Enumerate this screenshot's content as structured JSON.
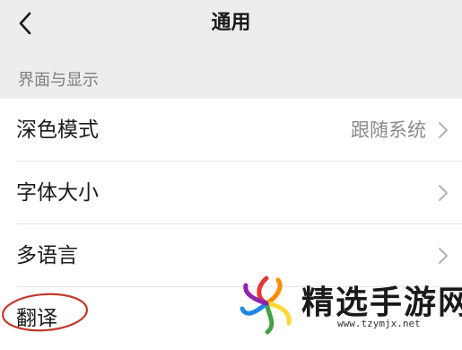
{
  "nav": {
    "title": "通用",
    "back_icon": "chevron-left-icon"
  },
  "section": {
    "header": "界面与显示"
  },
  "rows": [
    {
      "label": "深色模式",
      "value": "跟随系统",
      "icon": "chevron-right-icon"
    },
    {
      "label": "字体大小",
      "value": "",
      "icon": "chevron-right-icon"
    },
    {
      "label": "多语言",
      "value": "",
      "icon": "chevron-right-icon"
    },
    {
      "label": "翻译",
      "value": "",
      "icon": ""
    }
  ],
  "annotation": {
    "highlight_color": "#c0392b"
  },
  "watermark": {
    "name": "精选手游网",
    "url": "www.tzymjx.net",
    "colors": [
      "#e53935",
      "#fb8c00",
      "#fdd835",
      "#43a047",
      "#1e88e5",
      "#8e24aa"
    ]
  },
  "colors": {
    "background": "#ededed",
    "list_background": "#ffffff",
    "text_primary": "#1a1a1a",
    "text_secondary": "#8a8a8a"
  }
}
